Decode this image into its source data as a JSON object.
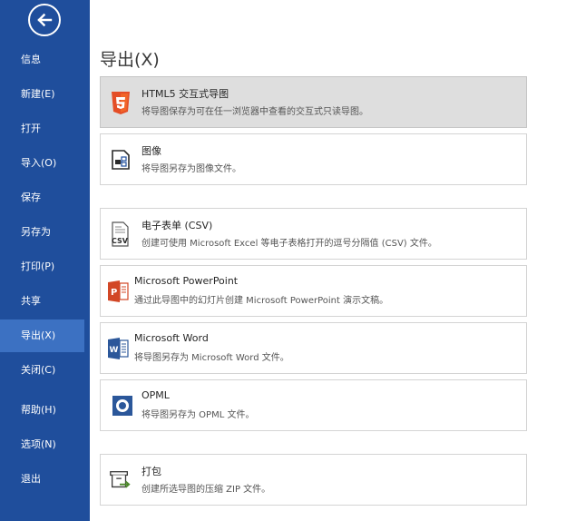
{
  "sidebar": {
    "items": [
      {
        "label": "信息"
      },
      {
        "label": "新建(E)"
      },
      {
        "label": "打开"
      },
      {
        "label": "导入(O)"
      },
      {
        "label": "保存"
      },
      {
        "label": "另存为"
      },
      {
        "label": "打印(P)"
      },
      {
        "label": "共享"
      },
      {
        "label": "导出(X)"
      },
      {
        "label": "关闭(C)"
      },
      {
        "label": "帮助(H)"
      },
      {
        "label": "选项(N)"
      },
      {
        "label": "退出"
      }
    ],
    "active_item": "导出(X)",
    "background_color": "#1f4e9c",
    "active_color": "#3c71c2"
  },
  "main": {
    "title": "导出(X)",
    "options": [
      {
        "title": "HTML5 交互式导图",
        "desc": "将导图保存为可在任一浏览器中查看的交互式只读导图。",
        "icon": "html5-icon",
        "selected": true
      },
      {
        "title": "图像",
        "desc": "将导图另存为图像文件。",
        "icon": "image-export-icon"
      },
      {
        "title": "电子表单 (CSV)",
        "desc": "创建可使用 Microsoft Excel 等电子表格打开的逗号分隔值 (CSV) 文件。",
        "icon": "csv-file-icon"
      },
      {
        "title": "Microsoft PowerPoint",
        "desc": "通过此导图中的幻灯片创建 Microsoft PowerPoint 演示文稿。",
        "icon": "powerpoint-icon"
      },
      {
        "title": "Microsoft Word",
        "desc": "将导图另存为 Microsoft Word 文件。",
        "icon": "word-icon"
      },
      {
        "title": "OPML",
        "desc": "将导图另存为 OPML 文件。",
        "icon": "opml-icon"
      },
      {
        "title": "打包",
        "desc": "创建所选导图的压缩 ZIP 文件。",
        "icon": "package-zip-icon"
      }
    ]
  }
}
